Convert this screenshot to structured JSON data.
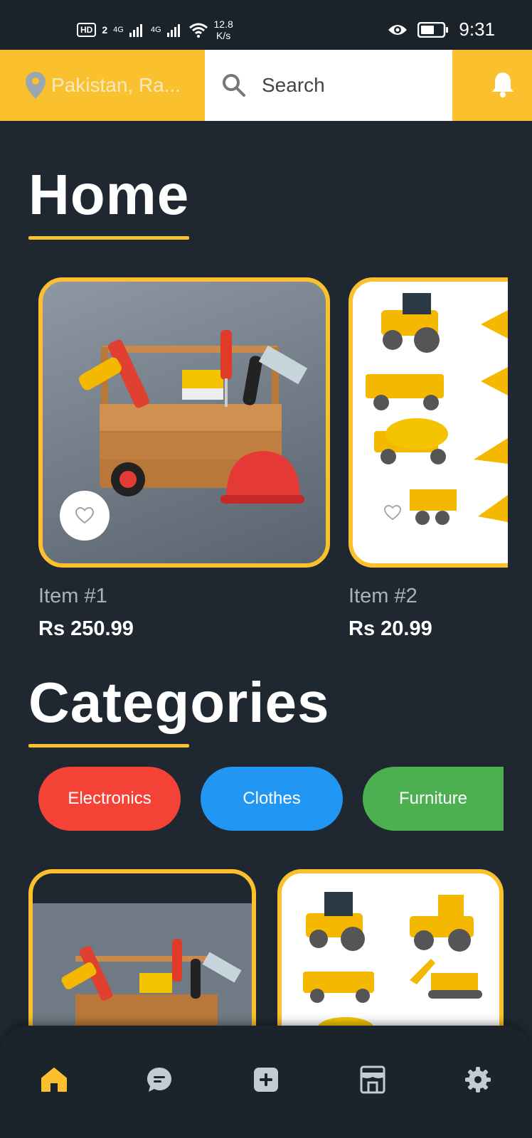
{
  "status_bar": {
    "hd_badge": "HD",
    "sim_number": "2",
    "network1": "4G",
    "network2": "4G",
    "speed_value": "12.8",
    "speed_unit": "K/s",
    "time": "9:31"
  },
  "top_bar": {
    "location": "Pakistan, Ra...",
    "search_label": "Search",
    "accent_color": "#fbc02d"
  },
  "home": {
    "title": "Home",
    "items": [
      {
        "name": "Item #1",
        "price": "Rs 250.99"
      },
      {
        "name": "Item #2",
        "price": "Rs 20.99"
      }
    ]
  },
  "categories": {
    "title": "Categories",
    "chips": [
      {
        "label": "Electronics",
        "color": "#f44336"
      },
      {
        "label": "Clothes",
        "color": "#2196f3"
      },
      {
        "label": "Furniture",
        "color": "#4caf50"
      }
    ]
  },
  "bottom_nav": {
    "items": [
      "home-icon",
      "chat-icon",
      "add-icon",
      "store-icon",
      "settings-icon"
    ],
    "active_color": "#fbc02d",
    "inactive_color": "#c3ccd4"
  }
}
